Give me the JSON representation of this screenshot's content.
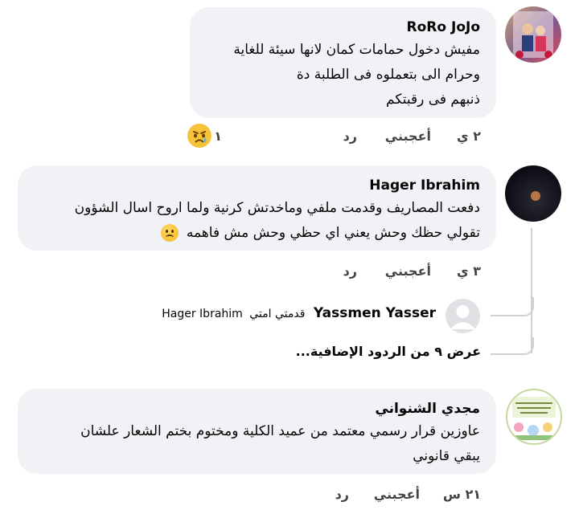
{
  "comments": [
    {
      "author": "RoRo JoJo",
      "lines": [
        "مفيش دخول حمامات كمان لانها سيئة للغاية",
        "وحرام الى بتعملوه فى الطلبة دة",
        "ذنبهم فى رقبتكم"
      ],
      "time": "٢ ي",
      "like_label": "أعجبني",
      "reply_label": "رد",
      "reaction_count": "١",
      "reaction_icon": "sad-reaction-icon"
    },
    {
      "author": "Hager Ibrahim",
      "lines": [
        "دفعت المصاريف وقدمت ملفي وماخدتش كرنية ولما اروح اسال الشؤون",
        "تقولي حظك وحش يعني اي حظي وحش مش فاهمه"
      ],
      "time": "٣ ي",
      "like_label": "أعجبني",
      "reply_label": "رد",
      "inline_emoji": "frowning-face-icon"
    },
    {
      "author": "مجدي الشنواني",
      "lines": [
        "عاوزين قرار رسمي معتمد من عميد الكلية ومختوم بختم الشعار علشان",
        "يبقي قانوني"
      ],
      "time": "٢١ س",
      "like_label": "أعجبني",
      "reply_label": "رد"
    }
  ],
  "reply_preview": {
    "author": "Yassmen Yasser",
    "text": "قدمتي امتي",
    "mention": "Hager Ibrahim"
  },
  "view_more_replies": "عرض ٩ من الردود الإضافية...",
  "colors": {
    "bubble": "#f0f2f5",
    "thread_line": "#ced0d4",
    "text": "#050505"
  }
}
